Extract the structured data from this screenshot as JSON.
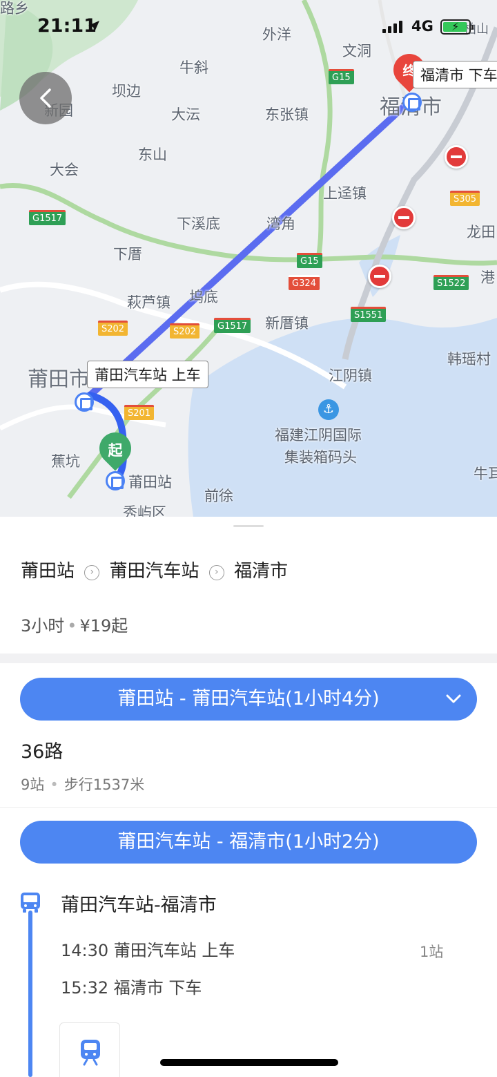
{
  "status_bar": {
    "time": "21:11",
    "network": "4G"
  },
  "map": {
    "places": [
      {
        "text": "路乡"
      },
      {
        "text": "外洋"
      },
      {
        "text": "文洞"
      },
      {
        "text": "牛斜"
      },
      {
        "text": "坝边"
      },
      {
        "text": "新园"
      },
      {
        "text": "大沄"
      },
      {
        "text": "东张镇"
      },
      {
        "text": "东山"
      },
      {
        "text": "大会"
      },
      {
        "text": "上迳镇"
      },
      {
        "text": "下溪底"
      },
      {
        "text": "湾角"
      },
      {
        "text": "龙田"
      },
      {
        "text": "下厝"
      },
      {
        "text": "港"
      },
      {
        "text": "萩芦镇"
      },
      {
        "text": "坞底"
      },
      {
        "text": "新厝镇"
      },
      {
        "text": "韩瑶村"
      },
      {
        "text": "江阴镇"
      },
      {
        "text": "蕉坑"
      },
      {
        "text": "莆田站"
      },
      {
        "text": "前徐"
      },
      {
        "text": "秀屿区"
      },
      {
        "text": "牛耳"
      },
      {
        "text": "福建江阴国际"
      },
      {
        "text": "集装箱码头"
      },
      {
        "text": "柏山"
      }
    ],
    "city_labels": [
      "福清市",
      "莆田市"
    ],
    "road_shields": [
      {
        "text": "G15",
        "color": "green"
      },
      {
        "text": "G1517",
        "color": "green"
      },
      {
        "text": "G15",
        "color": "green"
      },
      {
        "text": "G324",
        "color": "red"
      },
      {
        "text": "S305",
        "color": "yellow"
      },
      {
        "text": "S1522",
        "color": "green"
      },
      {
        "text": "S1551",
        "color": "green"
      },
      {
        "text": "G1517",
        "color": "green"
      },
      {
        "text": "S202",
        "color": "yellow"
      },
      {
        "text": "S202",
        "color": "yellow"
      },
      {
        "text": "S201",
        "color": "yellow"
      }
    ],
    "board_callout": "莆田汽车站 上车",
    "alight_callout": "福清市 下车",
    "start_pin_label": "起",
    "end_pin_label": "终",
    "route_color": "#5b6cf0",
    "accent_color": "#4d86f2"
  },
  "summary": {
    "stops": [
      "莆田站",
      "莆田汽车站",
      "福清市"
    ],
    "duration": "3小时",
    "price": "¥19起"
  },
  "segments": [
    {
      "title": "莆田站 - 莆田汽车站(1小时4分)",
      "line_name": "36路",
      "stop_count": "9站",
      "walk": "步行1537米"
    },
    {
      "title": "莆田汽车站 - 福清市(1小时2分)",
      "bus_route": "莆田汽车站-福清市",
      "board_time": "14:30 莆田汽车站 上车",
      "alight_time": "15:32 福清市 下车",
      "stops_label": "1站"
    }
  ]
}
